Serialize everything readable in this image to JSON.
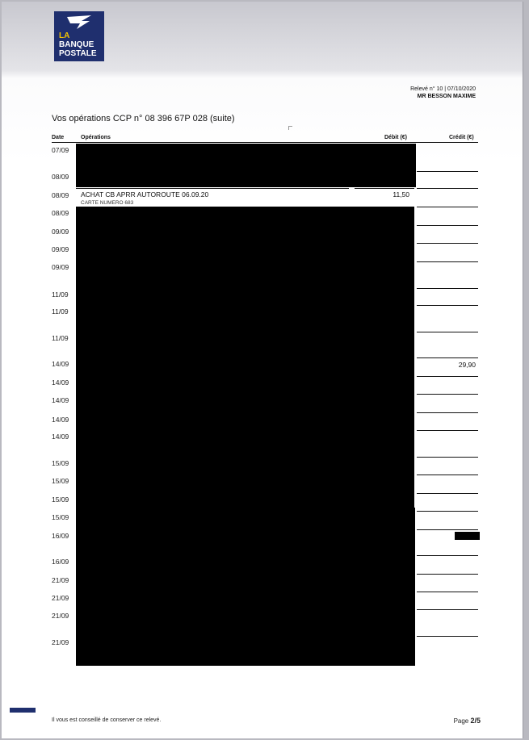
{
  "logo": {
    "line1": "LA",
    "line2": "BANQUE",
    "line3": "POSTALE"
  },
  "header": {
    "statement": "Relevé n° 10 | 07/10/2020",
    "holder": "MR BESSON MAXIME"
  },
  "title": "Vos opérations CCP n° 08 396 67P 028 (suite)",
  "table": {
    "col_date": "Date",
    "col_ops": "Opérations",
    "col_debit": "Débit (€)",
    "col_credit": "Crédit (€)"
  },
  "dates": [
    "07/09",
    "08/09",
    "08/09",
    "08/09",
    "09/09",
    "09/09",
    "09/09",
    "11/09",
    "11/09",
    "11/09",
    "14/09",
    "14/09",
    "14/09",
    "14/09",
    "14/09",
    "15/09",
    "15/09",
    "15/09",
    "15/09",
    "16/09",
    "16/09",
    "21/09",
    "21/09",
    "21/09",
    "21/09"
  ],
  "visible_operation": {
    "label": "ACHAT CB APRR AUTOROUTE 06.09.20",
    "detail": "CARTE NUMERO 683",
    "debit": "11,50"
  },
  "credit_visible": "29,90",
  "footer": {
    "note": "Il vous est conseillé de conserver ce relevé.",
    "page_label": "Page",
    "page_value": "2/5"
  }
}
